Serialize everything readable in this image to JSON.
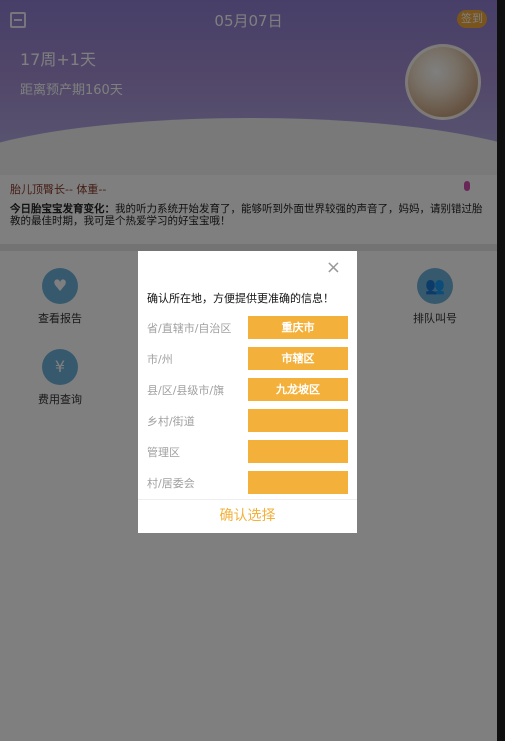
{
  "header": {
    "date": "05月07日",
    "sign_in": "签到",
    "weeks": "17周+1天",
    "due": "距离预产期160天"
  },
  "info": {
    "title": "胎儿顶臀长-- 体重--",
    "body_label": "今日胎宝宝发育变化：",
    "body_text": "我的听力系统开始发育了，能够听到外面世界较强的声音了，妈妈，请别错过胎教的最佳时期，我可是个热爱学习的好宝宝哦！"
  },
  "grid": [
    {
      "label": "查看报告",
      "icon": "heart-icon",
      "glyph": "♥"
    },
    {
      "label": "排队叫号",
      "icon": "people-icon",
      "glyph": "👥"
    },
    {
      "label": "费用查询",
      "icon": "yen-icon",
      "glyph": "¥"
    }
  ],
  "dialog": {
    "close": "×",
    "title": "确认所在地，方便提供更准确的信息！",
    "rows": [
      {
        "label": "省/直辖市/自治区",
        "value": "重庆市"
      },
      {
        "label": "市/州",
        "value": "市辖区"
      },
      {
        "label": "县/区/县级市/旗",
        "value": "九龙坡区"
      },
      {
        "label": "乡村/街道",
        "value": ""
      },
      {
        "label": "管理区",
        "value": ""
      },
      {
        "label": "村/居委会",
        "value": ""
      }
    ],
    "confirm": "确认选择"
  },
  "colors": {
    "accent": "#f3b13c",
    "header_top": "#8f7fd2",
    "icon_blue": "#6fb3dc"
  }
}
